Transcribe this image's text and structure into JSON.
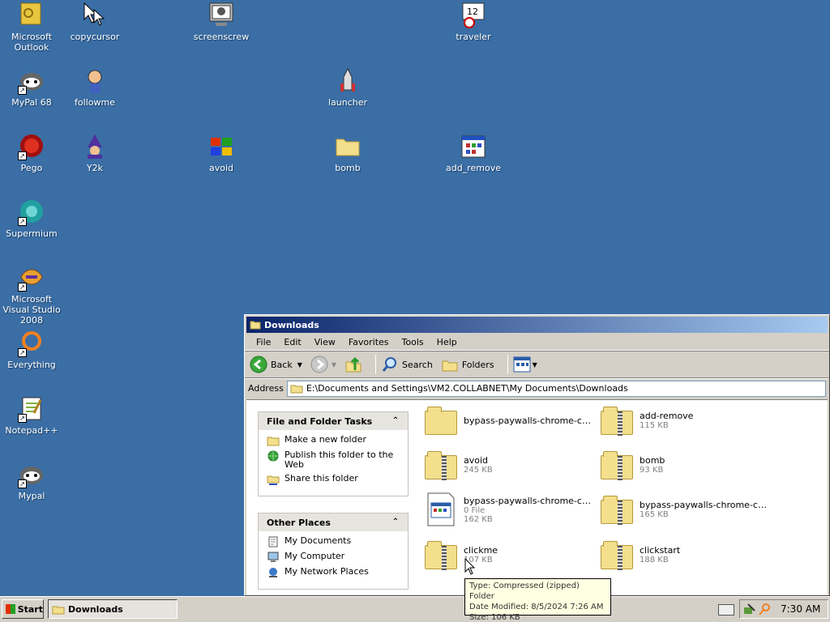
{
  "desktop": {
    "icons": [
      {
        "label": "Microsoft Outlook",
        "icon": "outlook-icon",
        "shortcut": false
      },
      {
        "label": "copycursor",
        "icon": "cursor-icon",
        "shortcut": false
      },
      {
        "label": "screenscrew",
        "icon": "screen-skull-icon",
        "shortcut": false
      },
      {
        "label": "traveler",
        "icon": "clock-calendar-icon",
        "shortcut": false
      },
      {
        "label": "MyPal 68",
        "icon": "raccoon-icon",
        "shortcut": true
      },
      {
        "label": "followme",
        "icon": "character-icon",
        "shortcut": false
      },
      {
        "label": "launcher",
        "icon": "rocket-icon",
        "shortcut": false
      },
      {
        "label": "Pego",
        "icon": "red-ball-icon",
        "shortcut": true
      },
      {
        "label": "Y2k",
        "icon": "wizard-icon",
        "shortcut": false
      },
      {
        "label": "avoid",
        "icon": "windows-flag-icon",
        "shortcut": false
      },
      {
        "label": "bomb",
        "icon": "folder-icon",
        "shortcut": false
      },
      {
        "label": "add_remove",
        "icon": "add-remove-programs-icon",
        "shortcut": false
      },
      {
        "label": "Supermium",
        "icon": "browser-icon",
        "shortcut": true
      },
      {
        "label": "Microsoft Visual Studio 2008",
        "icon": "visual-studio-icon",
        "shortcut": true
      },
      {
        "label": "Everything",
        "icon": "search-ring-icon",
        "shortcut": true
      },
      {
        "label": "Notepad++",
        "icon": "notepadpp-icon",
        "shortcut": true
      },
      {
        "label": "Mypal",
        "icon": "raccoon-icon",
        "shortcut": true
      }
    ]
  },
  "window": {
    "title": "Downloads",
    "menu": [
      "File",
      "Edit",
      "View",
      "Favorites",
      "Tools",
      "Help"
    ],
    "toolbar": {
      "back": "Back",
      "search": "Search",
      "folders": "Folders"
    },
    "address_label": "Address",
    "address": "E:\\Documents and Settings\\VM2.COLLABNET\\My Documents\\Downloads",
    "tasks": {
      "title": "File and Folder Tasks",
      "items": [
        "Make a new folder",
        "Publish this folder to the Web",
        "Share this folder"
      ]
    },
    "places": {
      "title": "Other Places",
      "items": [
        "My Documents",
        "My Computer",
        "My Network Places"
      ]
    },
    "files": [
      {
        "name": "bypass-paywalls-chrome-clea...",
        "meta1": "",
        "meta2": "",
        "type": "folder"
      },
      {
        "name": "add-remove",
        "meta1": "115 KB",
        "meta2": "",
        "type": "zip"
      },
      {
        "name": "avoid",
        "meta1": "245 KB",
        "meta2": "",
        "type": "zip"
      },
      {
        "name": "bomb",
        "meta1": "93 KB",
        "meta2": "",
        "type": "zip"
      },
      {
        "name": "bypass-paywalls-chrome-clea...",
        "meta1": "0 File",
        "meta2": "162 KB",
        "type": "file"
      },
      {
        "name": "bypass-paywalls-chrome-clea...",
        "meta1": "165 KB",
        "meta2": "",
        "type": "zip"
      },
      {
        "name": "clickme",
        "meta1": "107 KB",
        "meta2": "",
        "type": "zip"
      },
      {
        "name": "clickstart",
        "meta1": "188 KB",
        "meta2": "",
        "type": "zip"
      }
    ]
  },
  "tooltip": {
    "line1": "Type: Compressed (zipped) Folder",
    "line2": "Date Modified: 8/5/2024 7:26 AM",
    "line3": "Size: 106 KB"
  },
  "taskbar": {
    "start": "Start",
    "task": "Downloads",
    "clock": "7:30 AM"
  }
}
